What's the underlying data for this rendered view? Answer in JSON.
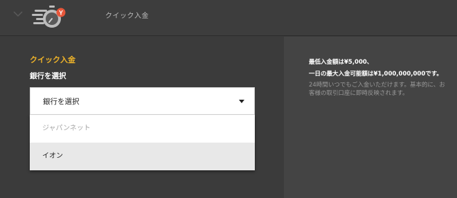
{
  "header": {
    "title": "クイック入金",
    "logo_badge": "Y",
    "accent_color": "#f0b429",
    "badge_color": "#e8573b"
  },
  "form": {
    "section_title": "クイック入金",
    "field_label": "銀行を選択",
    "select": {
      "selected_value": "銀行を選択",
      "options": [
        {
          "label": "ジャパンネット",
          "state": "disabled"
        },
        {
          "label": "イオン",
          "state": "hover"
        }
      ]
    }
  },
  "info": {
    "line1": "最低入金額は¥5,000、",
    "line2": "一日の最大入金可能額は¥1,000,000,000です。",
    "note": "24時間いつでもご入金いただけます。基本的に、お客様の取引口座に即時反映されます。"
  },
  "icons": {
    "collapse": "chevron-down-icon",
    "logo": "speed-coin-logo-icon",
    "caret": "caret-down-icon"
  }
}
